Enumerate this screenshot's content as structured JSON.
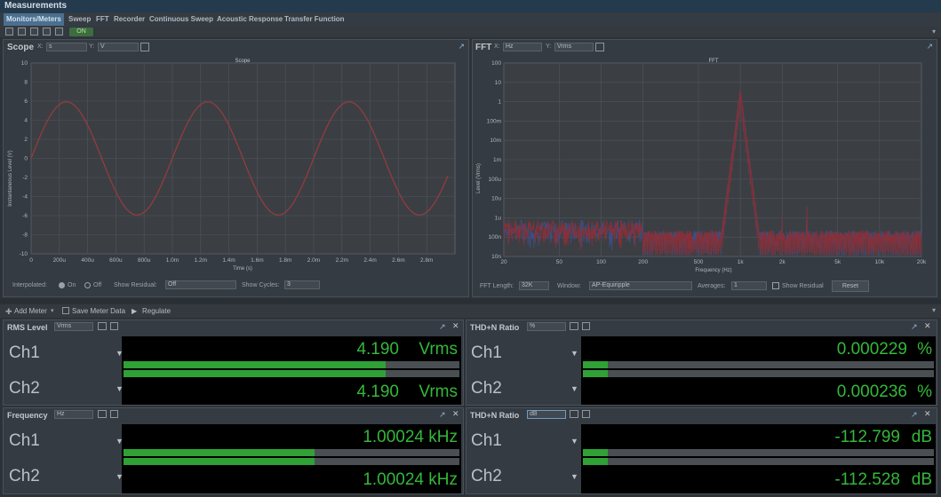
{
  "app": {
    "title": "Measurements"
  },
  "tabs": [
    "Monitors/Meters",
    "Sweep",
    "FFT",
    "Recorder",
    "Continuous Sweep",
    "Acoustic Response",
    "Transfer Function"
  ],
  "toolbar": {
    "on_label": "ON"
  },
  "scope": {
    "title": "Scope",
    "x_label": "X:",
    "x_unit": "s",
    "y_label": "Y:",
    "y_unit": "V",
    "chart_title": "Scope",
    "ylabel": "Instantaneous Level (V)",
    "xlabel": "Time (s)",
    "interpolated_label": "Interpolated:",
    "on_label": "On",
    "off_label": "Off",
    "show_residual_label": "Show Residual:",
    "show_residual_value": "Off",
    "show_cycles_label": "Show Cycles:",
    "show_cycles_value": "3"
  },
  "fft": {
    "title": "FFT",
    "x_label": "X:",
    "x_unit": "Hz",
    "y_label": "Y:",
    "y_unit": "Vrms",
    "chart_title": "FFT",
    "ylabel": "Level (Vrms)",
    "xlabel": "Frequency (Hz)",
    "fft_length_label": "FFT Length:",
    "fft_length_value": "32K",
    "window_label": "Window:",
    "window_value": "AP-Equiripple",
    "averages_label": "Averages:",
    "averages_value": "1",
    "show_residual_label": "Show Residual",
    "reset_label": "Reset"
  },
  "meter_toolbar": {
    "add_meter": "Add Meter",
    "save_meter_data": "Save Meter Data",
    "regulate": "Regulate"
  },
  "meters": [
    {
      "title": "RMS Level",
      "unit_select": "Vrms",
      "bar_color": "#2fa137",
      "channels": [
        {
          "name": "Ch1",
          "value": "4.190",
          "unit": "Vrms",
          "level": 0.78
        },
        {
          "name": "Ch2",
          "value": "4.190",
          "unit": "Vrms",
          "level": 0.78
        }
      ]
    },
    {
      "title": "THD+N Ratio",
      "unit_select": "%",
      "channels": [
        {
          "name": "Ch1",
          "value": "0.000229",
          "unit": "%",
          "level": 0.07
        },
        {
          "name": "Ch2",
          "value": "0.000236",
          "unit": "%",
          "level": 0.07
        }
      ]
    },
    {
      "title": "Frequency",
      "unit_select": "Hz",
      "channels": [
        {
          "name": "Ch1",
          "value": "1.00024",
          "unit": "kHz",
          "level": 0.57
        },
        {
          "name": "Ch2",
          "value": "1.00024",
          "unit": "kHz",
          "level": 0.57
        }
      ]
    },
    {
      "title": "THD+N Ratio",
      "unit_select": "dB",
      "channels": [
        {
          "name": "Ch1",
          "value": "-112.799",
          "unit": "dB",
          "level": 0.07
        },
        {
          "name": "Ch2",
          "value": "-112.528",
          "unit": "dB",
          "level": 0.07
        }
      ]
    }
  ],
  "chart_data": [
    {
      "type": "line",
      "title": "Scope",
      "xlabel": "Time (s)",
      "ylabel": "Instantaneous Level (V)",
      "x_ticks": [
        "0",
        "200u",
        "400u",
        "600u",
        "800u",
        "1.0m",
        "1.2m",
        "1.4m",
        "1.6m",
        "1.8m",
        "2.0m",
        "2.2m",
        "2.4m",
        "2.6m",
        "2.8m"
      ],
      "y_ticks": [
        "10",
        "8",
        "6",
        "4",
        "2",
        "0",
        "-2",
        "-4",
        "-6",
        "-8",
        "-10"
      ],
      "xlim": [
        0,
        0.003
      ],
      "ylim": [
        -10,
        10
      ],
      "series": [
        {
          "amplitude": 5.93,
          "frequency_hz": 1000.24,
          "color": "#9a3b3b"
        }
      ],
      "grid": true
    },
    {
      "type": "line",
      "title": "FFT",
      "xlabel": "Frequency (Hz)",
      "ylabel": "Level (Vrms)",
      "x_ticks": [
        "20",
        "50",
        "100",
        "200",
        "500",
        "1k",
        "2k",
        "5k",
        "10k",
        "20k"
      ],
      "y_ticks": [
        "100",
        "10",
        "1",
        "100m",
        "10m",
        "1m",
        "100u",
        "10u",
        "1u",
        "100n",
        "10n"
      ],
      "xlim": [
        20,
        20000
      ],
      "ylim": [
        1e-08,
        100
      ],
      "xscale": "log",
      "yscale": "log",
      "peaks": [
        {
          "x": 1000,
          "y": 4.19
        },
        {
          "x": 2000,
          "y": 1e-06
        },
        {
          "x": 3000,
          "y": 4e-06
        }
      ],
      "series_colors": [
        "#8a2f35",
        "#3e4e86"
      ],
      "grid": true
    }
  ]
}
